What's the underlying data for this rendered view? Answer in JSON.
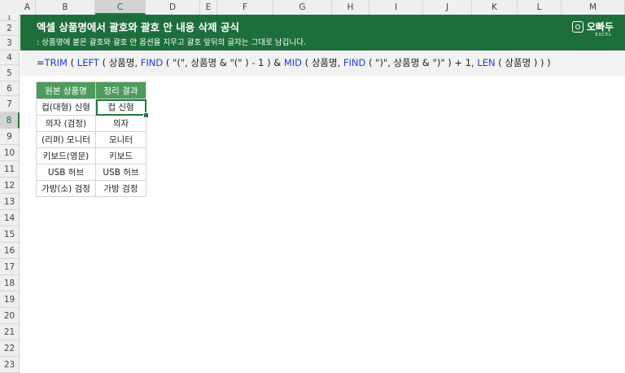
{
  "columns": [
    "A",
    "B",
    "C",
    "D",
    "E",
    "F",
    "G",
    "H",
    "I",
    "J",
    "K",
    "L",
    "M"
  ],
  "selected_column": "C",
  "rows": [
    "1",
    "2",
    "3",
    "4",
    "5",
    "6",
    "7",
    "8",
    "9",
    "10",
    "11",
    "12",
    "13",
    "14",
    "15",
    "16",
    "17",
    "18",
    "19",
    "20",
    "21",
    "22",
    "23"
  ],
  "selected_row": "8",
  "banner": {
    "title": "엑셀 상품명에서 괄호와 괄호 안 내용 삭제 공식",
    "subtitle": ": 상품명에 붙은 괄호와 괄호 안 옵션을 지우고 괄호 앞뒤의 글자는 그대로 남깁니다.",
    "logo_text": "오빠두",
    "logo_small": "EXCEL"
  },
  "formula": {
    "parts": [
      {
        "t": "=",
        "fn": false
      },
      {
        "t": "TRIM",
        "fn": true
      },
      {
        "t": " ( ",
        "fn": false
      },
      {
        "t": "LEFT",
        "fn": true
      },
      {
        "t": " ( 상품명, ",
        "fn": false
      },
      {
        "t": "FIND",
        "fn": true
      },
      {
        "t": " ( \"(\", 상품명 & \"(\" ) - 1 ) & ",
        "fn": false
      },
      {
        "t": "MID",
        "fn": true
      },
      {
        "t": " ( 상품명, ",
        "fn": false
      },
      {
        "t": "FIND",
        "fn": true
      },
      {
        "t": " ( \")\", 상품명 & \")\" ) + 1, ",
        "fn": false
      },
      {
        "t": "LEN",
        "fn": true
      },
      {
        "t": " ( 상품명 ) ) )",
        "fn": false
      }
    ]
  },
  "table": {
    "headers": [
      "원본 상품명",
      "정리 결과"
    ],
    "rows": [
      [
        "컵(대형) 신형",
        "컵 신형"
      ],
      [
        "의자 (검정)",
        "의자"
      ],
      [
        "(리퍼) 모니터",
        "모니터"
      ],
      [
        "키보드(영문)",
        "키보드"
      ],
      [
        "USB 허브",
        "USB 허브"
      ],
      [
        "가방(소) 검정",
        "가방 검정"
      ]
    ]
  }
}
